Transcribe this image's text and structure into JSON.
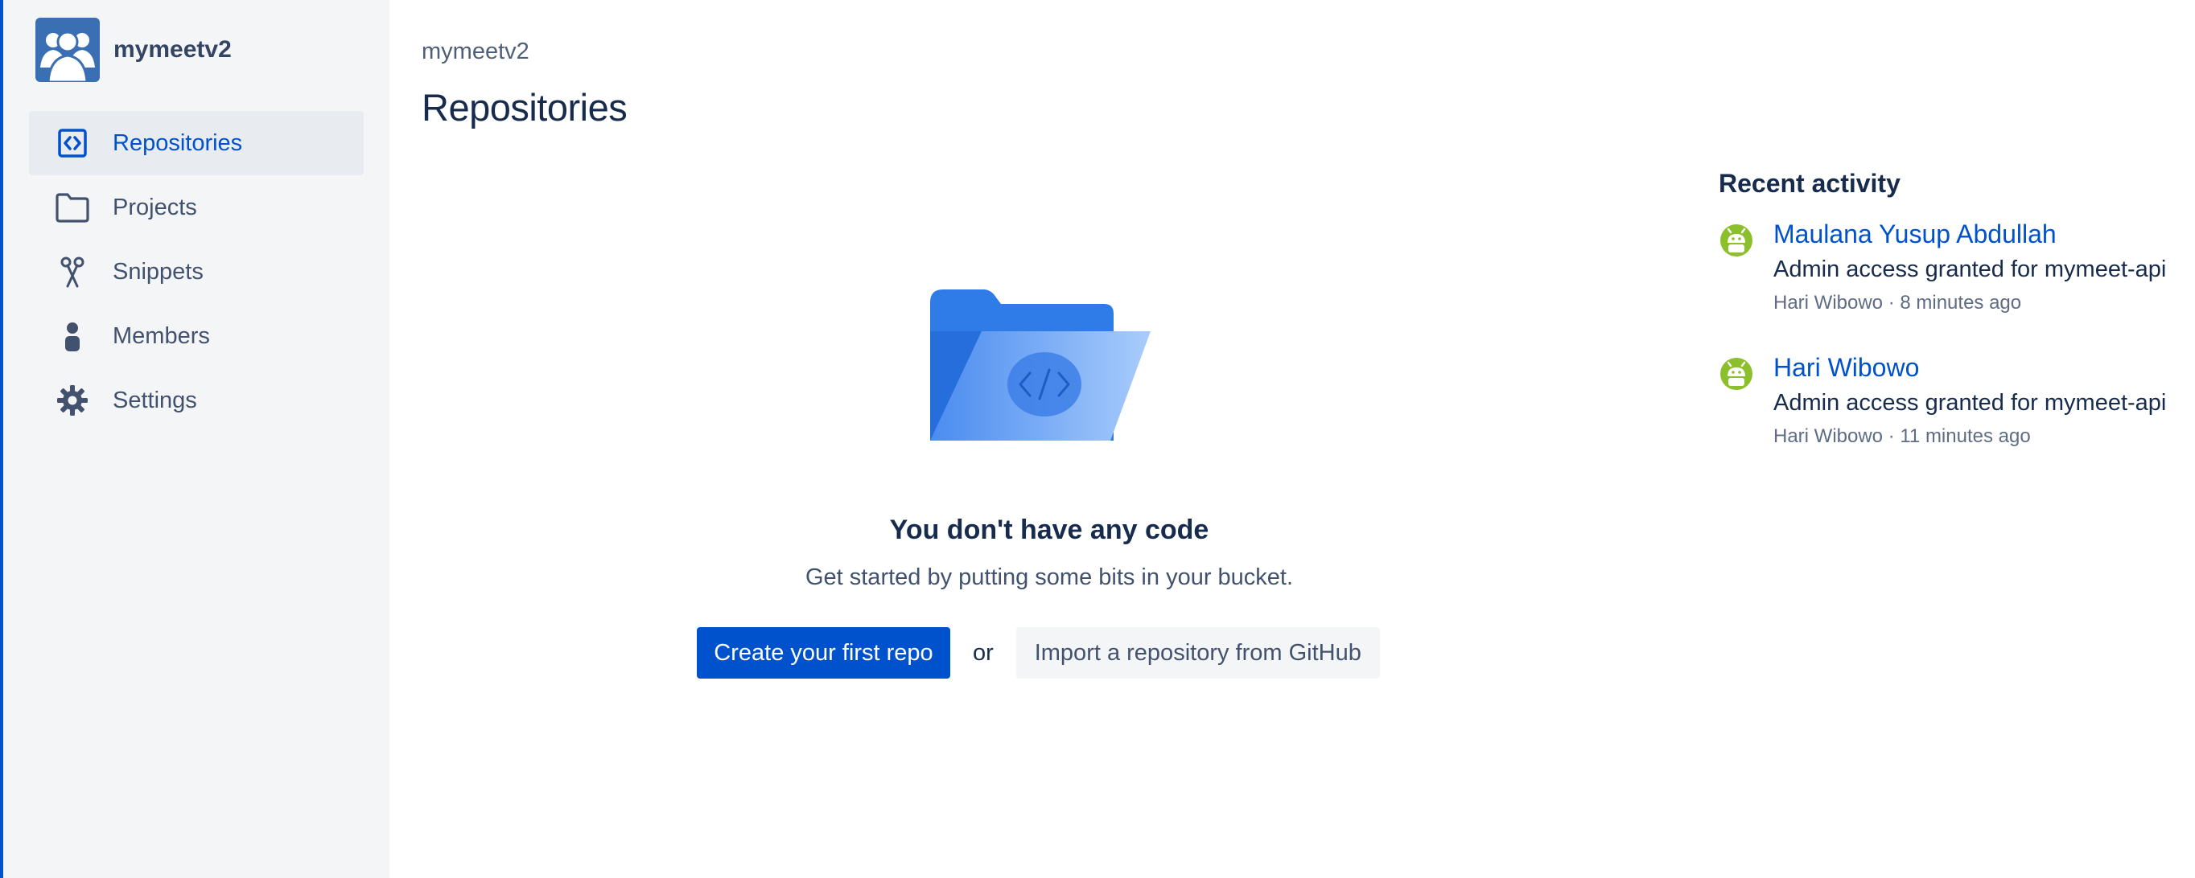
{
  "workspace": {
    "name": "mymeetv2"
  },
  "sidebar": {
    "items": [
      {
        "label": "Repositories",
        "icon": "repository-icon",
        "active": true
      },
      {
        "label": "Projects",
        "icon": "folder-icon",
        "active": false
      },
      {
        "label": "Snippets",
        "icon": "scissors-icon",
        "active": false
      },
      {
        "label": "Members",
        "icon": "person-icon",
        "active": false
      },
      {
        "label": "Settings",
        "icon": "gear-icon",
        "active": false
      }
    ]
  },
  "main": {
    "breadcrumb": "mymeetv2",
    "title": "Repositories",
    "empty_state": {
      "title": "You don't have any code",
      "subtitle": "Get started by putting some bits in your bucket.",
      "primary_action": "Create your first repo",
      "separator": "or",
      "secondary_action": "Import a repository from GitHub"
    }
  },
  "activity": {
    "title": "Recent activity",
    "items": [
      {
        "name": "Maulana Yusup Abdullah",
        "description": "Admin access granted for mymeet-api",
        "meta": "Hari Wibowo · 8 minutes ago"
      },
      {
        "name": "Hari Wibowo",
        "description": "Admin access granted for mymeet-api",
        "meta": "Hari Wibowo · 11 minutes ago"
      }
    ]
  },
  "colors": {
    "accent": "#0052cc",
    "sidebar_bg": "#f4f5f7",
    "avatar_green": "#8bbf2b"
  }
}
